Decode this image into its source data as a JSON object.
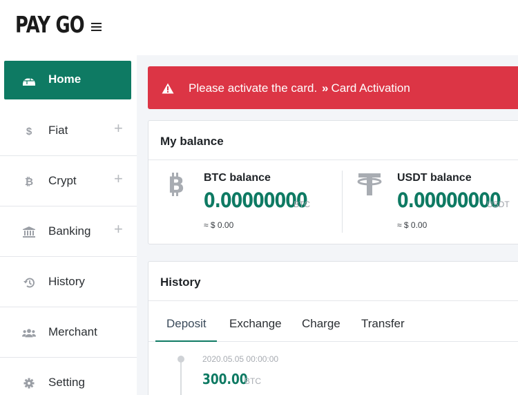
{
  "header": {
    "logo": "PAY GO"
  },
  "sidebar": {
    "items": [
      {
        "label": "Home",
        "icon": "igloo-icon",
        "active": true
      },
      {
        "label": "Fiat",
        "icon": "dollar-icon",
        "expandable": true
      },
      {
        "label": "Crypt",
        "icon": "bitcoin-icon",
        "expandable": true
      },
      {
        "label": "Banking",
        "icon": "bank-icon",
        "expandable": true
      },
      {
        "label": "History",
        "icon": "history-icon"
      },
      {
        "label": "Merchant",
        "icon": "users-icon"
      },
      {
        "label": "Setting",
        "icon": "gear-icon"
      }
    ]
  },
  "alert": {
    "message": "Please activate the card.",
    "link": "Card Activation",
    "color": "#dc3545"
  },
  "balance": {
    "title": "My balance",
    "btc": {
      "label": "BTC balance",
      "amount": "0.00000000",
      "unit": "BTC",
      "usd": "≈ $ 0.00"
    },
    "usdt": {
      "label": "USDT balance",
      "amount": "0.00000000",
      "unit": "USDT",
      "usd": "≈ $ 0.00"
    }
  },
  "history": {
    "title": "History",
    "tabs": [
      "Deposit",
      "Exchange",
      "Charge",
      "Transfer"
    ],
    "active_tab": "Deposit",
    "entries": [
      {
        "date": "2020.05.05 00:00:00",
        "amount": "300.00",
        "unit": "BTC"
      }
    ]
  },
  "colors": {
    "accent": "#0e7a63",
    "danger": "#dc3545"
  }
}
